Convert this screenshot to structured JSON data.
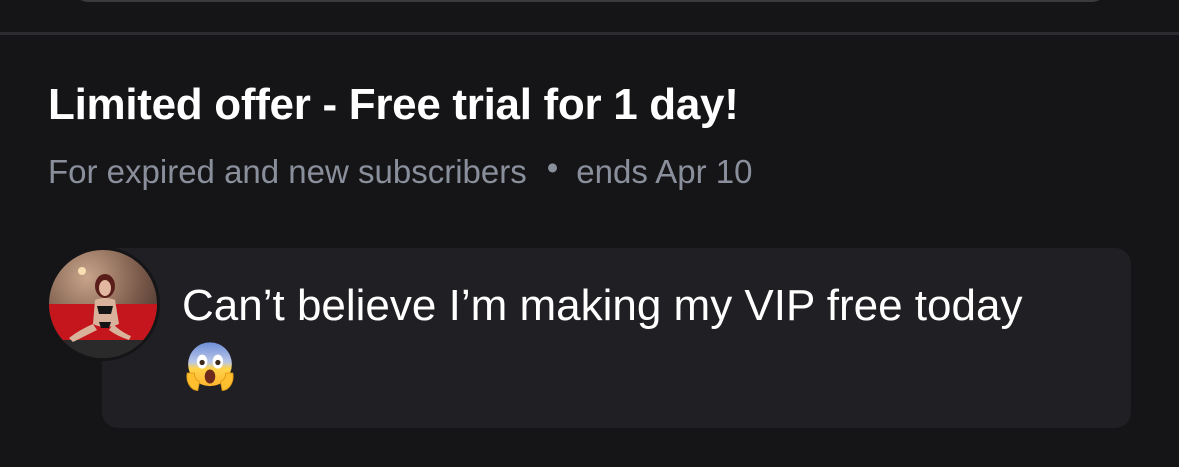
{
  "offer": {
    "title": "Limited offer - Free trial for 1 day!",
    "audience": "For expired and new subscribers",
    "separator": "•",
    "ends": "ends Apr 10"
  },
  "message": {
    "text": "Can’t believe I’m making my VIP free today",
    "emoji": "face-screaming-in-fear-icon"
  },
  "colors": {
    "background": "#151517",
    "bubble": "#202024",
    "muted_text": "#8a8f9c",
    "divider": "#2c2c30"
  }
}
